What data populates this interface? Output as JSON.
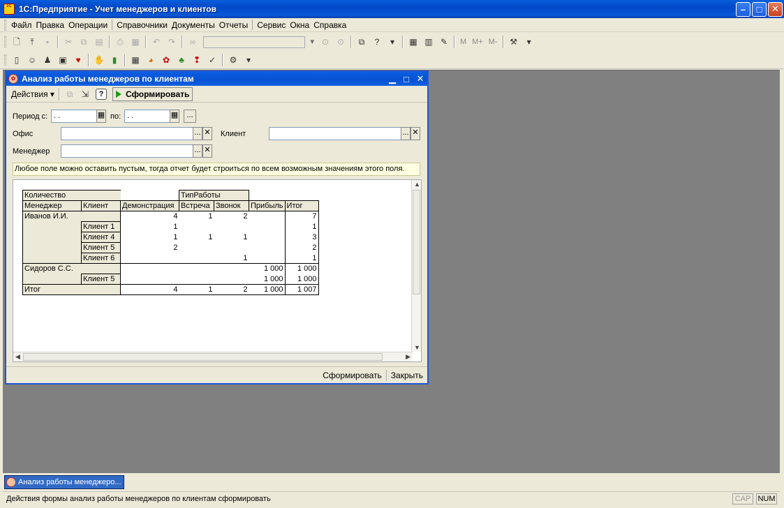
{
  "window": {
    "icon_text": "1C",
    "title": "1С:Предприятие - Учет менеджеров и клиентов",
    "min": "–",
    "max": "□",
    "close": "✕"
  },
  "menu": [
    "Файл",
    "Правка",
    "Операции",
    "Справочники",
    "Документы",
    "Отчеты",
    "Сервис",
    "Окна",
    "Справка"
  ],
  "toolbar": {
    "memory_buttons": [
      "M",
      "M+",
      "M-"
    ]
  },
  "form": {
    "title": "Анализ работы менеджеров по клиентам",
    "actions_label": "Действия",
    "generate_label": "Сформировать",
    "help_label": "?",
    "period_from_label": "Период с:",
    "period_to_label": "по:",
    "date_placeholder": " .  .",
    "office_label": "Офис",
    "client_label": "Клиент",
    "manager_label": "Менеджер",
    "hint": "Любое поле можно оставить пустым, тогда отчет будет строиться по всем возможным значениям этого поля.",
    "bottom_generate": "Сформировать",
    "bottom_close": "Закрыть"
  },
  "report": {
    "measure": "Количество",
    "column_group": "ТипРаботы",
    "headers": [
      "Менеджер",
      "Клиент",
      "Демонстрация",
      "Встреча",
      "Звонок",
      "Прибыль",
      "Итог"
    ],
    "rows": [
      {
        "manager": "Иванов И.И.",
        "client": "",
        "demo": "4",
        "meet": "1",
        "call": "2",
        "profit": "",
        "total": "7"
      },
      {
        "manager": "",
        "client": "Клиент 1",
        "demo": "1",
        "meet": "",
        "call": "",
        "profit": "",
        "total": "1"
      },
      {
        "manager": "",
        "client": "Клиент 4",
        "demo": "1",
        "meet": "1",
        "call": "1",
        "profit": "",
        "total": "3"
      },
      {
        "manager": "",
        "client": "Клиент 5",
        "demo": "2",
        "meet": "",
        "call": "",
        "profit": "",
        "total": "2"
      },
      {
        "manager": "",
        "client": "Клиент 6",
        "demo": "",
        "meet": "",
        "call": "1",
        "profit": "",
        "total": "1"
      },
      {
        "manager": "Сидоров С.С.",
        "client": "",
        "demo": "",
        "meet": "",
        "call": "",
        "profit": "1 000",
        "total": "1 000"
      },
      {
        "manager": "",
        "client": "Клиент 5",
        "demo": "",
        "meet": "",
        "call": "",
        "profit": "1 000",
        "total": "1 000"
      },
      {
        "manager": "Итог",
        "client": "",
        "demo": "4",
        "meet": "1",
        "call": "2",
        "profit": "1 000",
        "total": "1 007"
      }
    ]
  },
  "taskbar": {
    "task": "Анализ работы менеджеро..."
  },
  "status": {
    "text": "Действия формы анализ работы менеджеров по клиентам сформировать",
    "cap": "CAP",
    "num": "NUM"
  }
}
